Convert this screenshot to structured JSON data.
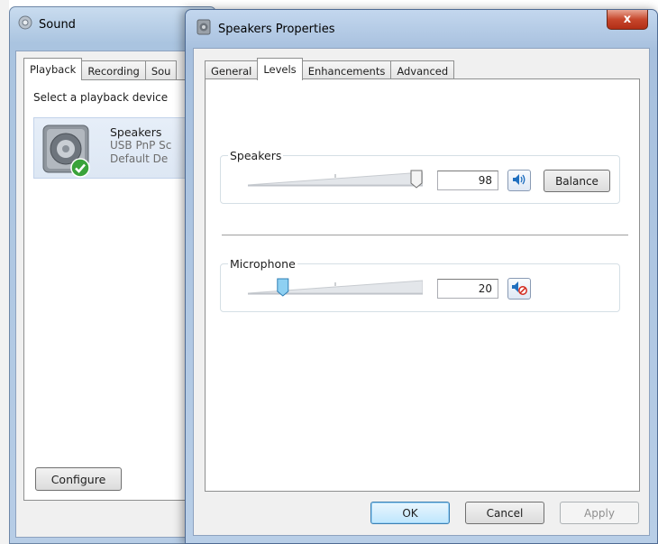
{
  "sound_window": {
    "title": "Sound",
    "tabs": [
      {
        "label": "Playback"
      },
      {
        "label": "Recording"
      },
      {
        "label": "Sou"
      }
    ],
    "instruction": "Select a playback device",
    "device": {
      "name": "Speakers",
      "sub1": "USB PnP Sc",
      "sub2": "Default De"
    },
    "configure_label": "Configure"
  },
  "properties_window": {
    "title": "Speakers Properties",
    "close_label": "x",
    "tabs": [
      {
        "label": "General"
      },
      {
        "label": "Levels"
      },
      {
        "label": "Enhancements"
      },
      {
        "label": "Advanced"
      }
    ],
    "speakers": {
      "label": "Speakers",
      "value": "98",
      "level": 0.98,
      "balance_label": "Balance",
      "mute_icon": "speaker-on-icon"
    },
    "microphone": {
      "label": "Microphone",
      "value": "20",
      "level": 0.2,
      "mute_icon": "speaker-muted-icon"
    },
    "buttons": {
      "ok": "OK",
      "cancel": "Cancel",
      "apply": "Apply"
    }
  },
  "colors": {
    "title_bar": "#a7c0de",
    "close_red": "#c7472c",
    "selection_blue": "#dde7f4",
    "thumb_blue": "#5bb6e8"
  }
}
